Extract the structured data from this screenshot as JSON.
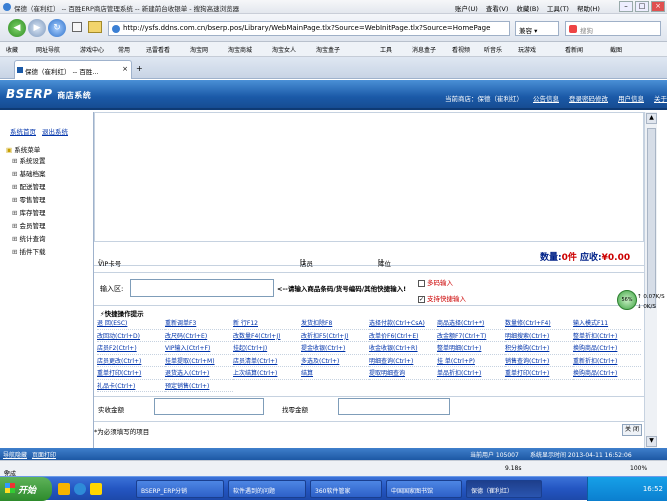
{
  "browser": {
    "window_title": "保德（崔利红） -- 百胜ERP商店管理系统 -- 新建前台收银单 - 搜狗高速浏览器",
    "menus": [
      "账户(U)",
      "查看(V)",
      "收藏(B)",
      "工具(T)",
      "帮助(H)"
    ],
    "back_icon": "◀",
    "forward_icon": "▶",
    "refresh_icon": "↻",
    "address": "http://ysfs.ddns.com.cn/bserp.pos/Library/WebMainPage.tlx?Source=WebInitPage.tlx?Source=HomePage",
    "mode_label": "兼容",
    "search_placeholder": "搜狗",
    "favorites": [
      "收藏",
      "网址导航",
      "游戏中心",
      "常用",
      "迅雷看看",
      "淘宝网",
      "淘宝商城",
      "淘宝女人",
      "淘宝盒子",
      "工具",
      "消息盒子",
      "看视频",
      "听音乐",
      "玩游戏",
      "看新闻",
      "截图"
    ],
    "tab_title": "保德（崔利红） -- 百胜..."
  },
  "app": {
    "logo": "BSERP",
    "logo_sub": "商店系统",
    "header_links": [
      "当前商店：保德（崔利红）",
      "公告信息",
      "登录密码修改",
      "用户信息",
      "关于"
    ],
    "side_top": [
      "系统首页",
      "退出系统"
    ],
    "tree_root": "系统菜单",
    "tree_items": [
      "系统设置",
      "基础档案",
      "配送管理",
      "零售管理",
      "库存管理",
      "会员管理",
      "统计查询",
      "插件下载"
    ],
    "vip_label": "VIP卡号",
    "shop_label": "店员",
    "shop_value": "[]",
    "stock_label": "库位",
    "stock_value": "[]",
    "qty_label": "数量:",
    "qty_value": "0件",
    "due_label": "应收:",
    "due_value": "¥0.00",
    "input_label": "输入区:",
    "input_hint": "<--请输入商品条码/货号编码/其他快捷输入!",
    "check_multi": "多码输入",
    "check_shortcut": "支持快捷输入",
    "check_multi_state": "",
    "check_shortcut_state": "✓",
    "quick_title": "快捷操作提示",
    "quick_ops": [
      "退 回(ESC)",
      "重新调单F3",
      "新 行F12",
      "发货扣除F8",
      "选择付款(Ctrl+CsA)",
      "商品选择(Ctrl+*)",
      "数量修(Ctrl+F4)",
      "输入模式F11",
      "改回动(Ctrl+D)",
      "改尺码(Ctrl+E)",
      "改数量F4(Ctrl+J)",
      "改折扣F5(Ctrl+J)",
      "改单价F6(Ctrl+E)",
      "改金额F7(Ctrl+T)",
      "明细搜索(Ctrl+)",
      "整单折扣(Ctrl+)",
      "店员F2(Ctrl+)",
      "VIP输入(Ctrl+F)",
      "挂起(Ctrl+J)",
      "提金收银(Ctrl+)",
      "收金收银(Ctrl+R)",
      "整单明细(Ctrl+)",
      "积分换购(Ctrl+)",
      "换购商品(Ctrl+)",
      "店员更改(Ctrl+)",
      "挂单提取(Ctrl+M)",
      "店员清单(Ctrl+)",
      "多选及(Ctrl+)",
      "明细查询(Ctrl+)",
      "挂 单(Ctrl+P)",
      "销售查询(Ctrl+)",
      "重新折扣(Ctrl+)",
      "重单打印(Ctrl+)",
      "退货选入(Ctrl+)",
      "上次结算(Ctrl+)",
      "结算",
      "提取明细查询",
      "单品折扣(Ctrl+)",
      "重单打印(Ctrl+)",
      "换购商品(Ctrl+)",
      "礼品卡(Ctrl+)",
      "预定销售(Ctrl+)"
    ],
    "pay_received_label": "实收金额",
    "pay_change_label": "找零金额",
    "note": "*为必须填写的项目",
    "close_label": "关 闭",
    "status_left": "导航隐藏",
    "status_left2": "页面打印",
    "status_user": "当前用户 105007",
    "status_time": "系统显示时间 2013-04-11 16:52:06"
  },
  "ie_status": {
    "left": "完成",
    "mid": "9.18s",
    "zoom": "100%"
  },
  "float": {
    "ball": "56%",
    "up": "0.07K/S",
    "down": "0K/S"
  },
  "taskbar": {
    "start": "开始",
    "tasks": [
      "BSERP_ERP分销",
      "软件遇到的问题",
      "360软件管家",
      "中国国家图书馆",
      "保德（崔利红）"
    ],
    "clock": "16:52"
  }
}
